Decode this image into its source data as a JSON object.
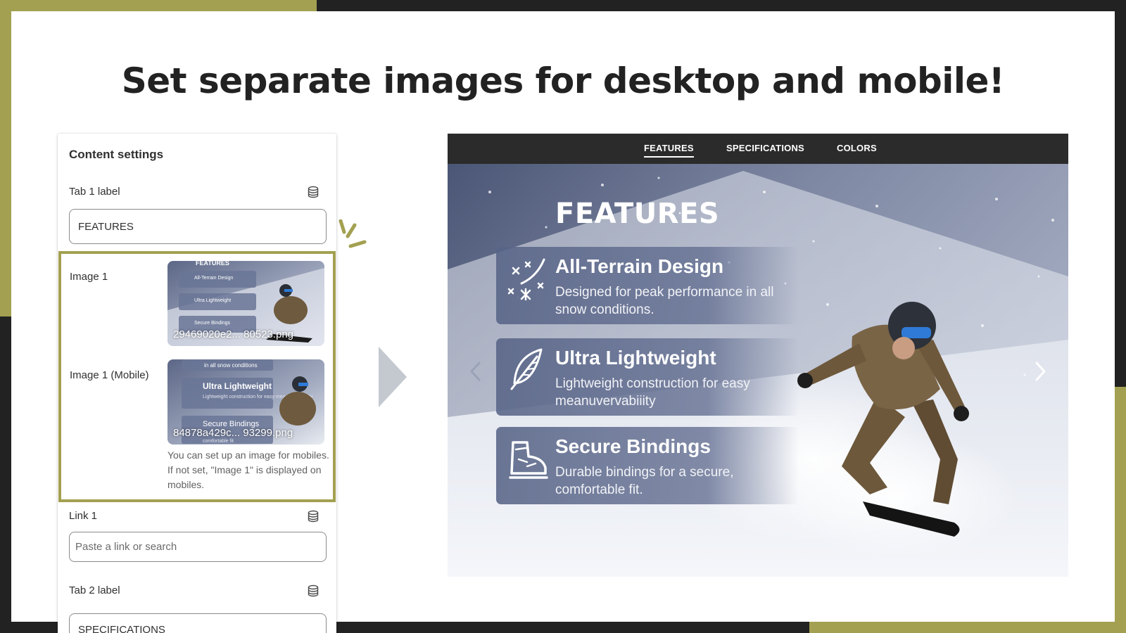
{
  "headline": "Set separate images for desktop and mobile!",
  "colors": {
    "accent_olive": "#a3a051",
    "dark": "#222222",
    "nav_bg": "#2b2b2b"
  },
  "panel": {
    "title": "Content settings",
    "tab1_label": "Tab 1 label",
    "tab1_value": "FEATURES",
    "image1_label": "Image 1",
    "image1_filename": "29469020e2... 80523.png",
    "image1_mobile_label": "Image 1 (Mobile)",
    "image1_mobile_filename": "84878a429c... 93299.png",
    "help_text": "You can set up an image for mobiles. If not set, \"Image 1\" is displayed on mobiles.",
    "link1_label": "Link 1",
    "link1_placeholder": "Paste a link or search",
    "tab2_label": "Tab 2 label",
    "tab2_value": "SPECIFICATIONS",
    "icons": [
      "database-icon",
      "database-icon",
      "database-icon"
    ]
  },
  "preview": {
    "tabs": [
      "FEATURES",
      "SPECIFICATIONS",
      "COLORS"
    ],
    "active_tab": "FEATURES",
    "hero_title": "FEATURES",
    "features": [
      {
        "title": "All-Terrain Design",
        "desc": "Designed for peak performance in all snow conditions.",
        "icon": "snowflake-icon"
      },
      {
        "title": "Ultra Lightweight",
        "desc": "Lightweight construction for easy meanuvervabiiity",
        "icon": "feather-icon"
      },
      {
        "title": "Secure Bindings",
        "desc": "Durable bindings for a secure, comfortable fit.",
        "icon": "boot-icon"
      }
    ],
    "thumb_texts": {
      "image1": [
        "FEATURES",
        "All-Terrain Design",
        "Ultra Lightweight",
        "Secure Bindings"
      ],
      "image1_mobile": [
        "in all snow conditions",
        "Ultra Lightweight",
        "Lightweight construction for easy meanuvervabiiity",
        "Secure Bindings",
        "comfortable fit"
      ]
    }
  }
}
